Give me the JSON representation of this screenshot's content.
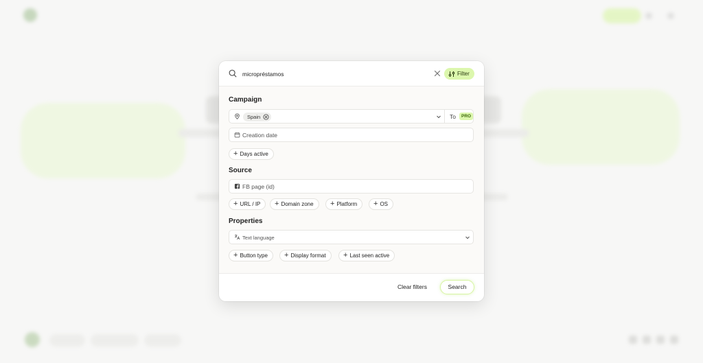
{
  "search": {
    "value": "micropréstamos",
    "filter_label": "Filter"
  },
  "campaign": {
    "title": "Campaign",
    "country_tag": "Spain",
    "to_label": "To",
    "pro_badge": "PRO",
    "creation_date_placeholder": "Creation date",
    "days_active_chip": "Days active"
  },
  "source": {
    "title": "Source",
    "fb_page_placeholder": "FB page (id)",
    "chips": [
      "URL / IP",
      "Domain zone",
      "Platform",
      "OS"
    ]
  },
  "properties": {
    "title": "Properties",
    "text_language_placeholder": "Text language",
    "chips": [
      "Button type",
      "Display format",
      "Last seen active"
    ]
  },
  "footer": {
    "clear_filters": "Clear filters",
    "search_button": "Search"
  },
  "colors": {
    "accent": "#dcf7ad",
    "accent_text": "#3d6a0a",
    "modal_bg": "#fbfaf8"
  },
  "icons": {
    "search": "search-icon",
    "clear": "close-icon",
    "filter": "sliders-icon",
    "location": "map-pin-icon",
    "calendar": "calendar-icon",
    "facebook": "facebook-icon",
    "language": "translate-icon",
    "dropdown": "chevron-down-icon"
  }
}
